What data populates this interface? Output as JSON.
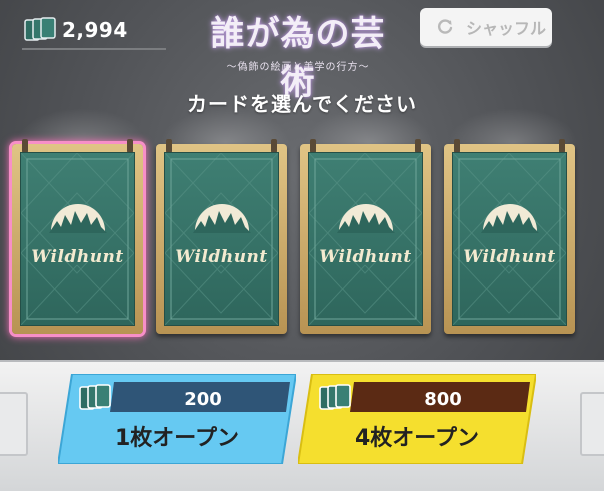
{
  "header": {
    "currency_value": "2,994",
    "currency_icon": "card-stack-icon",
    "logo_title": "誰が為の芸術",
    "logo_subtitle": "〜偽飾の絵画と美学の行方〜",
    "shuffle_label": "シャッフル",
    "shuffle_icon": "refresh-icon"
  },
  "prompt": "カードを選んでください",
  "cards": [
    {
      "brand": "Wildhunt",
      "selected": true
    },
    {
      "brand": "Wildhunt",
      "selected": false
    },
    {
      "brand": "Wildhunt",
      "selected": false
    },
    {
      "brand": "Wildhunt",
      "selected": false
    }
  ],
  "buttons": {
    "single": {
      "cost": "200",
      "label": "1枚オープン",
      "color": "#66c9f2",
      "cost_bg": "#2f5577"
    },
    "multi": {
      "cost": "800",
      "label": "4枚オープン",
      "color": "#f5df2e",
      "cost_bg": "#5b2a14"
    }
  },
  "colors": {
    "selected_outline": "#f26fb8",
    "card_face": "#3a7a6e",
    "card_frame": "#d4b370"
  }
}
